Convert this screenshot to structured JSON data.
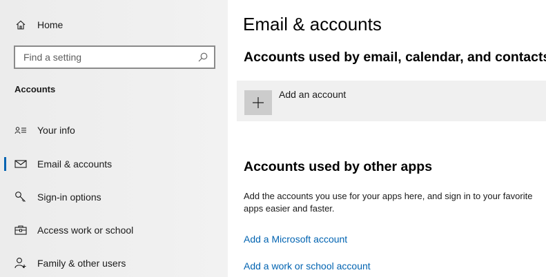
{
  "sidebar": {
    "home_label": "Home",
    "search": {
      "placeholder": "Find a setting"
    },
    "section_title": "Accounts",
    "items": [
      {
        "label": "Your info",
        "icon": "person-card-icon"
      },
      {
        "label": "Email & accounts",
        "icon": "envelope-icon",
        "active": true
      },
      {
        "label": "Sign-in options",
        "icon": "key-icon"
      },
      {
        "label": "Access work or school",
        "icon": "briefcase-icon"
      },
      {
        "label": "Family & other users",
        "icon": "person-add-icon"
      }
    ]
  },
  "main": {
    "title": "Email & accounts",
    "email_section": {
      "heading": "Accounts used by email, calendar, and contacts",
      "add_account_label": "Add an account"
    },
    "other_apps_section": {
      "heading": "Accounts used by other apps",
      "description": "Add the accounts you use for your apps here, and sign in to your favorite apps easier and faster.",
      "links": [
        "Add a Microsoft account",
        "Add a work or school account"
      ]
    }
  },
  "colors": {
    "accent": "#0063b1",
    "sidebar_bg": "#f0f0f0",
    "tile_bg": "#f0f0f0",
    "plus_bg": "#cccccc"
  }
}
